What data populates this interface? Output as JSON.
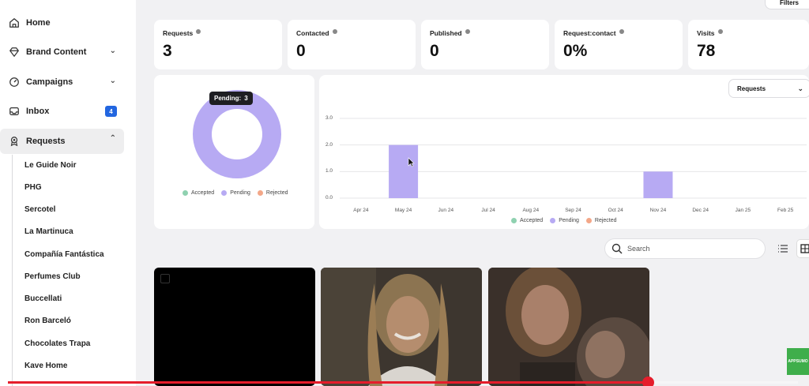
{
  "sidebar": {
    "items": [
      {
        "label": "Home",
        "icon": "home-icon"
      },
      {
        "label": "Brand Content",
        "icon": "diamond-icon"
      },
      {
        "label": "Campaigns",
        "icon": "gauge-icon"
      },
      {
        "label": "Inbox",
        "icon": "inbox-icon",
        "badge": "4"
      },
      {
        "label": "Requests",
        "icon": "award-icon"
      }
    ],
    "sub_items": [
      "Le Guide Noir",
      "PHG",
      "Sercotel",
      "La Martinuca",
      "Compañía Fantástica",
      "Perfumes Club",
      "Buccellati",
      "Ron Barceló",
      "Chocolates Trapa",
      "Kave Home"
    ]
  },
  "header": {
    "filters_label": "Filters"
  },
  "stats": [
    {
      "label": "Requests",
      "value": "3"
    },
    {
      "label": "Contacted",
      "value": "0"
    },
    {
      "label": "Published",
      "value": "0"
    },
    {
      "label": "Request:contact",
      "value": "0%"
    },
    {
      "label": "Visits",
      "value": "78"
    }
  ],
  "donut": {
    "tooltip_label": "Pending:",
    "tooltip_value": "3",
    "legend": [
      {
        "label": "Accepted",
        "color": "#8fd1b0"
      },
      {
        "label": "Pending",
        "color": "#b7aaf3"
      },
      {
        "label": "Rejected",
        "color": "#f3a788"
      }
    ]
  },
  "bar_chart": {
    "select_value": "Requests",
    "legend": [
      {
        "label": "Accepted",
        "color": "#8fd1b0"
      },
      {
        "label": "Pending",
        "color": "#b7aaf3"
      },
      {
        "label": "Rejected",
        "color": "#f3a788"
      }
    ]
  },
  "chart_data": [
    {
      "type": "pie",
      "categories": [
        "Accepted",
        "Pending",
        "Rejected"
      ],
      "values": [
        0,
        3,
        0
      ],
      "colors": [
        "#8fd1b0",
        "#b7aaf3",
        "#f3a788"
      ],
      "legend": "bottom"
    },
    {
      "type": "bar",
      "categories": [
        "Apr 24",
        "May 24",
        "Jun 24",
        "Jul 24",
        "Aug 24",
        "Sep 24",
        "Oct 24",
        "Nov 24",
        "Dec 24",
        "Jan 25",
        "Feb 25"
      ],
      "series": [
        {
          "name": "Accepted",
          "values": [
            0,
            0,
            0,
            0,
            0,
            0,
            0,
            0,
            0,
            0,
            0
          ],
          "color": "#8fd1b0"
        },
        {
          "name": "Pending",
          "values": [
            0,
            2,
            0,
            0,
            0,
            0,
            0,
            1,
            0,
            0,
            0
          ],
          "color": "#b7aaf3"
        },
        {
          "name": "Rejected",
          "values": [
            0,
            0,
            0,
            0,
            0,
            0,
            0,
            0,
            0,
            0,
            0
          ],
          "color": "#f3a788"
        }
      ],
      "yticks": [
        "0.0",
        "1.0",
        "2.0",
        "3.0"
      ],
      "ylim": [
        0,
        3
      ],
      "grid": true,
      "legend": "bottom"
    }
  ],
  "search": {
    "placeholder": "Search"
  },
  "video_badge": "APPSUMO",
  "video_progress": 0.81
}
